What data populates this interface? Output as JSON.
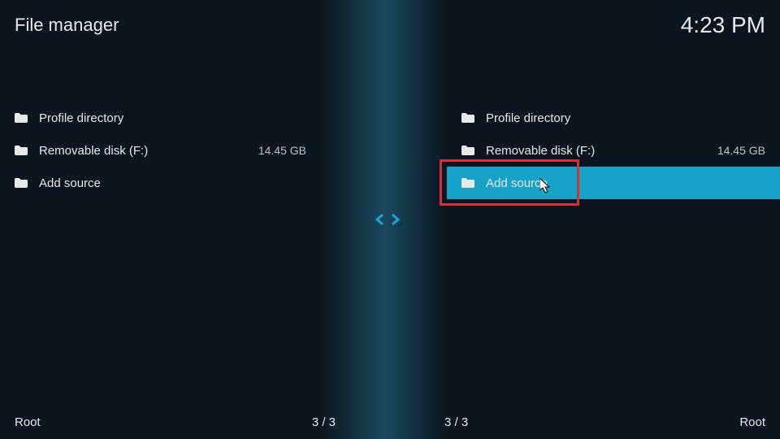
{
  "header": {
    "title": "File manager",
    "clock": "4:23 PM"
  },
  "left_pane": {
    "items": [
      {
        "label": "Profile directory",
        "size": ""
      },
      {
        "label": "Removable disk (F:)",
        "size": "14.45 GB"
      },
      {
        "label": "Add source",
        "size": ""
      }
    ]
  },
  "right_pane": {
    "items": [
      {
        "label": "Profile directory",
        "size": ""
      },
      {
        "label": "Removable disk (F:)",
        "size": "14.45 GB"
      },
      {
        "label": "Add source",
        "size": ""
      }
    ]
  },
  "footer": {
    "left_path": "Root",
    "left_count": "3 / 3",
    "right_count": "3 / 3",
    "right_path": "Root"
  }
}
